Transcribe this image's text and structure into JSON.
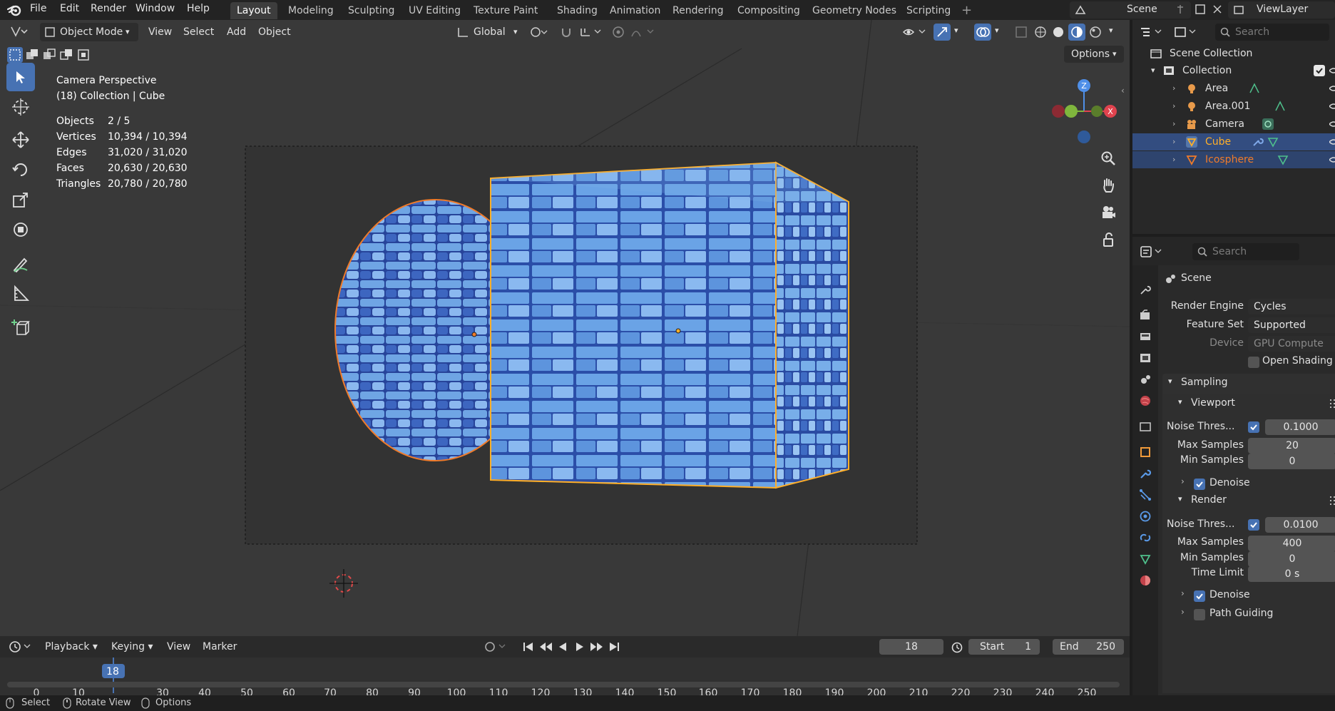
{
  "menu": {
    "file": "File",
    "edit": "Edit",
    "render": "Render",
    "window": "Window",
    "help": "Help"
  },
  "workspaces": [
    "Layout",
    "Modeling",
    "Sculpting",
    "UV Editing",
    "Texture Paint",
    "Shading",
    "Animation",
    "Rendering",
    "Compositing",
    "Geometry Nodes",
    "Scripting"
  ],
  "scene_name": "Scene",
  "view_layer": "ViewLayer",
  "viewport_header": {
    "mode": "Object Mode",
    "view": "View",
    "select": "Select",
    "add": "Add",
    "object": "Object",
    "orientation": "Global",
    "options": "Options"
  },
  "overlay_stats": {
    "camera": "Camera Perspective",
    "collection": "(18) Collection | Cube",
    "rows": [
      {
        "k": "Objects",
        "v": "2 / 5"
      },
      {
        "k": "Vertices",
        "v": "10,394 / 10,394"
      },
      {
        "k": "Edges",
        "v": "31,020 / 31,020"
      },
      {
        "k": "Faces",
        "v": "20,630 / 20,630"
      },
      {
        "k": "Triangles",
        "v": "20,780 / 20,780"
      }
    ]
  },
  "gizmo": {
    "z": "Z",
    "x": "X"
  },
  "timeline": {
    "playback": "Playback",
    "keying": "Keying",
    "view": "View",
    "marker": "Marker",
    "current_frame": "18",
    "start_label": "Start",
    "start": "1",
    "end_label": "End",
    "end": "250",
    "ruler": [
      "0",
      "10",
      "18",
      "30",
      "40",
      "50",
      "60",
      "70",
      "80",
      "90",
      "100",
      "110",
      "120",
      "130",
      "140",
      "150",
      "160",
      "170",
      "180",
      "190",
      "200",
      "210",
      "220",
      "230",
      "240",
      "250"
    ]
  },
  "statusbar": {
    "select": "Select",
    "rotate": "Rotate View",
    "options": "Options"
  },
  "outliner": {
    "search_placeholder": "Search",
    "scene_collection": "Scene Collection",
    "collection": "Collection",
    "items": [
      {
        "name": "Area",
        "color": "#e0e0e0",
        "selected": false,
        "active": false
      },
      {
        "name": "Area.001",
        "color": "#e0e0e0",
        "selected": false,
        "active": false
      },
      {
        "name": "Camera",
        "color": "#e0e0e0",
        "selected": false,
        "active": false
      },
      {
        "name": "Cube",
        "color": "#ffaf29",
        "selected": true,
        "active": true
      },
      {
        "name": "Icosphere",
        "color": "#f07b2a",
        "selected": true,
        "active": false
      }
    ]
  },
  "properties": {
    "search_placeholder": "Search",
    "context": "Scene",
    "render_engine_label": "Render Engine",
    "render_engine": "Cycles",
    "feature_set_label": "Feature Set",
    "feature_set": "Supported",
    "device_label": "Device",
    "device": "GPU Compute",
    "osl": "Open Shading L",
    "sampling": "Sampling",
    "viewport": "Viewport",
    "vp_noise_label": "Noise Thres...",
    "vp_noise": "0.1000",
    "vp_max_label": "Max Samples",
    "vp_max": "20",
    "vp_min_label": "Min Samples",
    "vp_min": "0",
    "denoise": "Denoise",
    "render": "Render",
    "r_noise_label": "Noise Thres...",
    "r_noise": "0.0100",
    "r_max_label": "Max Samples",
    "r_max": "400",
    "r_min_label": "Min Samples",
    "r_min": "0",
    "time_limit_label": "Time Limit",
    "time_limit": "0 s",
    "denoise2": "Denoise",
    "path_guiding": "Path Guiding"
  },
  "colors": {
    "accent": "#4772b3",
    "selection_orange": "#ffaf29",
    "tile_blue": "#5a8fd6"
  }
}
